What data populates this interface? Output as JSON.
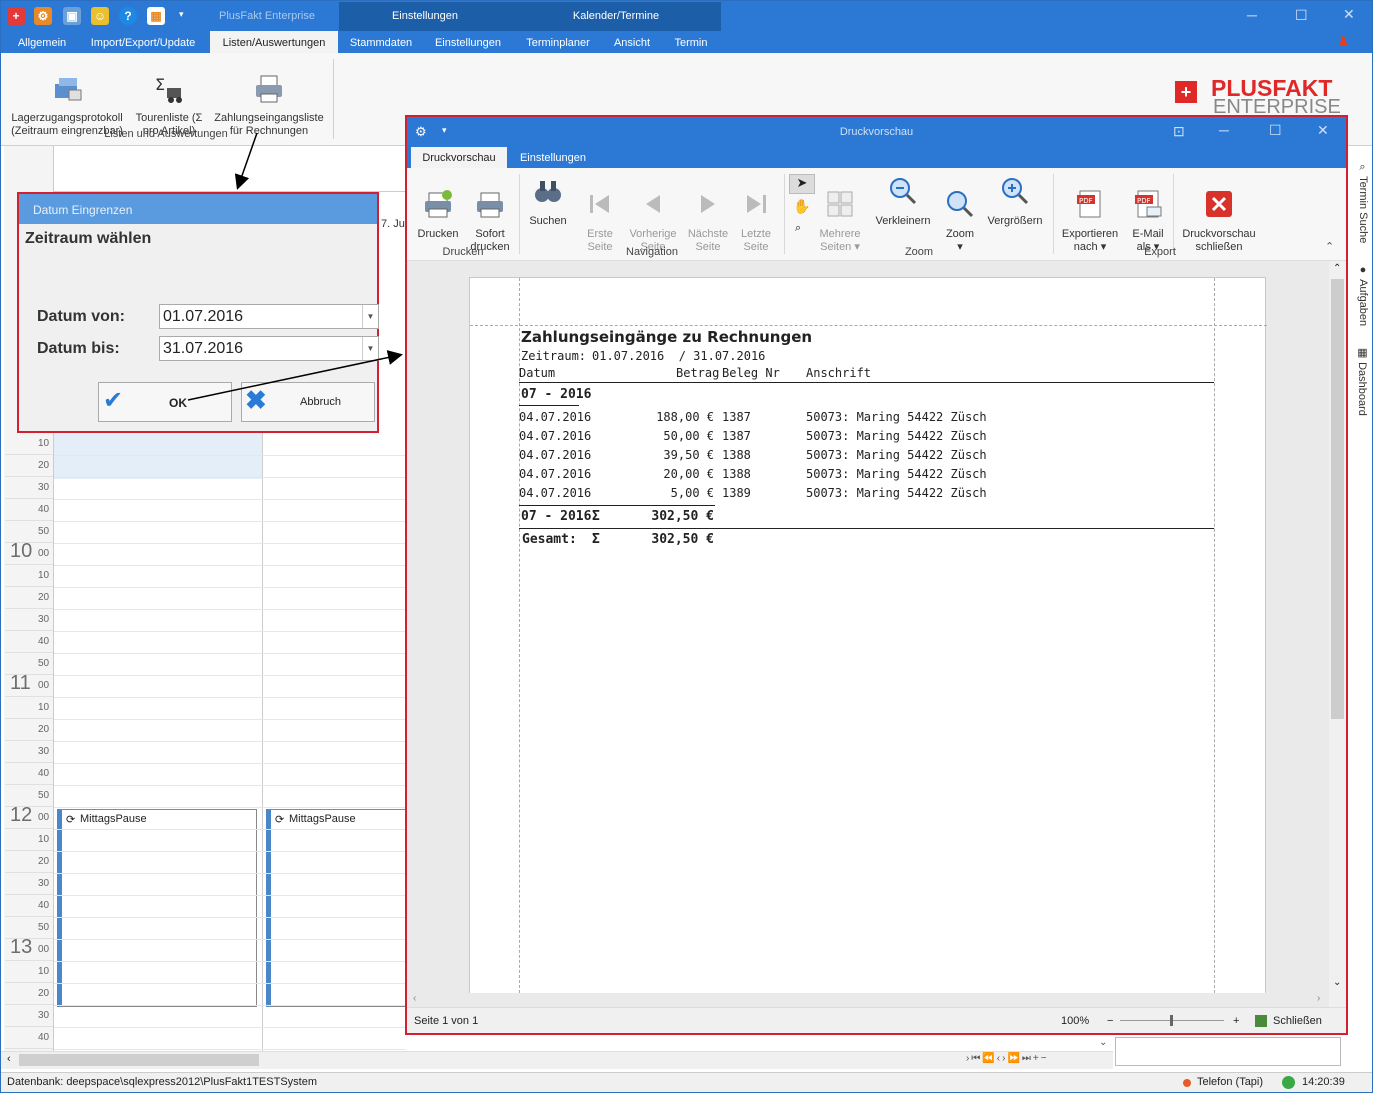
{
  "app": {
    "title": "PlusFakt Enterprise",
    "context_tabs": [
      "Einstellungen",
      "Kalender/Termine"
    ],
    "tabs": [
      "Allgemein",
      "Import/Export/Update",
      "Listen/Auswertungen",
      "Stammdaten",
      "Einstellungen",
      "Terminplaner",
      "Ansicht",
      "Termin"
    ],
    "ribbon": {
      "buttons": [
        {
          "label": "Lagerzugangsprotokoll\n(Zeitraum eingrenzbar)",
          "icon": "inventory-icon"
        },
        {
          "label": "Tourenliste (Σ\npro Artikel)",
          "icon": "sigma-truck-icon"
        },
        {
          "label": "Zahlungseingangsliste\nfür Rechnungen",
          "icon": "printer-list-icon"
        }
      ],
      "group": "Listen und Auswertungen"
    },
    "logo": {
      "line1": "PLUSFAKT",
      "line2": "ENTERPRISE"
    },
    "side_panels": [
      "Termin Suche",
      "Aufgaben",
      "Dashboard"
    ]
  },
  "calendar": {
    "hours": [
      {
        "hour": "10",
        "mins": [
          "00",
          "10",
          "20",
          "30",
          "40",
          "50"
        ]
      },
      {
        "hour": "11",
        "mins": [
          "00",
          "10",
          "20",
          "30",
          "40",
          "50"
        ]
      },
      {
        "hour": "12",
        "mins": [
          "00",
          "10",
          "20",
          "30",
          "40",
          "50"
        ]
      },
      {
        "hour": "13",
        "mins": [
          "00",
          "10",
          "20",
          "30",
          "40"
        ]
      }
    ],
    "pre_mins": [
      "10",
      "20",
      "30",
      "40",
      "50"
    ],
    "header_fragment": "7. Ju",
    "appointment": "MittagsPause"
  },
  "dialog": {
    "title": "Datum Eingrenzen",
    "heading": "Zeitraum wählen",
    "from_label": "Datum von:",
    "from_value": "01.07.2016",
    "to_label": "Datum bis:",
    "to_value": "31.07.2016",
    "ok": "OK",
    "cancel": "Abbruch"
  },
  "preview": {
    "title": "Druckvorschau",
    "tabs": [
      "Druckvorschau",
      "Einstellungen"
    ],
    "buttons": {
      "drucken": "Drucken",
      "sofort": "Sofort\ndrucken",
      "suchen": "Suchen",
      "erste": "Erste\nSeite",
      "vorherige": "Vorherige\nSeite",
      "naechste": "Nächste\nSeite",
      "letzte": "Letzte\nSeite",
      "mehrere": "Mehrere\nSeiten ▾",
      "verkleinern": "Verkleinern",
      "zoom": "Zoom\n▾",
      "vergroessern": "Vergrößern",
      "exportieren": "Exportieren\nnach ▾",
      "email": "E-Mail\nals ▾",
      "schliessen": "Druckvorschau\nschließen"
    },
    "groups": [
      "Drucken",
      "Navigation",
      "Zoom",
      "Export"
    ],
    "status": {
      "page": "Seite 1 von 1",
      "zoom": "100%",
      "close": "Schließen"
    }
  },
  "report": {
    "title": "Zahlungseingänge zu Rechnungen",
    "period_label": "Zeitraum:",
    "period": "01.07.2016  / 31.07.2016",
    "columns": [
      "Datum",
      "Betrag",
      "Beleg Nr",
      "Anschrift"
    ],
    "group": "07 - 2016",
    "rows": [
      {
        "date": "04.07.2016",
        "amount": "188,00 €",
        "nr": "1387",
        "addr": "50073: Maring 54422 Züsch"
      },
      {
        "date": "04.07.2016",
        "amount": "50,00 €",
        "nr": "1387",
        "addr": "50073: Maring 54422 Züsch"
      },
      {
        "date": "04.07.2016",
        "amount": "39,50 €",
        "nr": "1388",
        "addr": "50073: Maring 54422 Züsch"
      },
      {
        "date": "04.07.2016",
        "amount": "20,00 €",
        "nr": "1388",
        "addr": "50073: Maring 54422 Züsch"
      },
      {
        "date": "04.07.2016",
        "amount": "5,00 €",
        "nr": "1389",
        "addr": "50073: Maring 54422 Züsch"
      }
    ],
    "subtotal_label": "07 - 2016",
    "sigma": "Σ",
    "subtotal": "302,50 €",
    "total_label": "Gesamt:",
    "total": "302,50 €"
  },
  "status": {
    "db": "Datenbank: deepspace\\sqlexpress2012\\PlusFakt1TESTSystem",
    "phone": "Telefon (Tapi)",
    "time": "14:20:39"
  },
  "colors": {
    "accent": "#2b79d5",
    "highlight": "#d22030"
  }
}
